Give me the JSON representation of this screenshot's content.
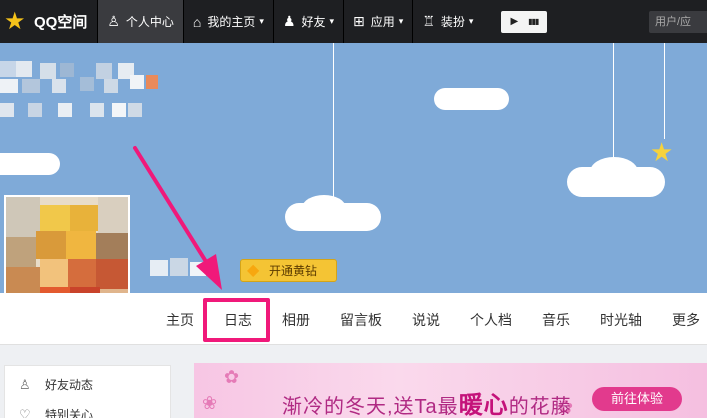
{
  "topbar": {
    "logo_text": "QQ空间",
    "nav": [
      {
        "label": "个人中心",
        "icon": "user-icon",
        "active": true,
        "dropdown": false
      },
      {
        "label": "我的主页",
        "icon": "home-icon",
        "active": false,
        "dropdown": true
      },
      {
        "label": "好友",
        "icon": "friends-icon",
        "active": false,
        "dropdown": true
      },
      {
        "label": "应用",
        "icon": "apps-icon",
        "active": false,
        "dropdown": true
      },
      {
        "label": "装扮",
        "icon": "shirt-icon",
        "active": false,
        "dropdown": true
      }
    ],
    "caret": "▾",
    "player_play": "▶",
    "player_bars": "▮▮▮",
    "user_box_text": "用户/应"
  },
  "profile": {
    "vip_button_label": "开通黄钻"
  },
  "tabs": [
    {
      "label": "主页"
    },
    {
      "label": "日志",
      "highlighted": true
    },
    {
      "label": "相册"
    },
    {
      "label": "留言板"
    },
    {
      "label": "说说"
    },
    {
      "label": "个人档"
    },
    {
      "label": "音乐"
    },
    {
      "label": "时光轴"
    },
    {
      "label": "更多"
    }
  ],
  "sidebar": {
    "items": [
      {
        "label": "好友动态",
        "icon": "person-outline-icon"
      },
      {
        "label": "特别关心",
        "icon": "heart-icon"
      }
    ]
  },
  "banner": {
    "text_part1": "渐冷的冬天,送Ta最",
    "text_big": "暖心",
    "text_part2": "的花藤",
    "button_label": "前往体验"
  },
  "colors": {
    "topbar_bg": "#1e1f22",
    "cover_sky": "#7faad8",
    "highlight": "#f0197a",
    "vip_gold": "#f4c434",
    "banner_pink": "#f7c6e4"
  }
}
